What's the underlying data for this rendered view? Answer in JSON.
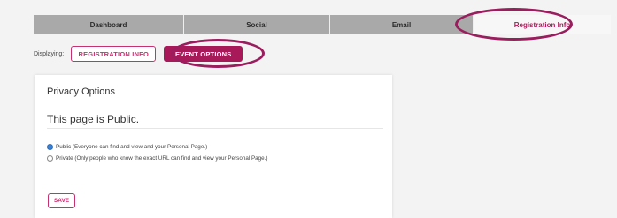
{
  "tabs": [
    {
      "label": "Dashboard",
      "active": false
    },
    {
      "label": "Social",
      "active": false
    },
    {
      "label": "Email",
      "active": false
    },
    {
      "label": "Registration Info",
      "active": true
    }
  ],
  "subnav": {
    "label": "Displaying:",
    "items": [
      {
        "label": "REGISTRATION INFO",
        "active": false
      },
      {
        "label": "EVENT OPTIONS",
        "active": true
      }
    ]
  },
  "panel": {
    "title": "Privacy Options",
    "status": "This page is Public.",
    "options": [
      {
        "label": "Public (Everyone can find and view and your Personal Page.)",
        "checked": true
      },
      {
        "label": "Private (Only people who know the exact URL can find and view your Personal Page.)",
        "checked": false
      }
    ],
    "save_label": "SAVE"
  },
  "colors": {
    "brand": "#a8195a",
    "highlight_ring": "#9a1d5e",
    "radio_checked": "#3b82d6"
  }
}
